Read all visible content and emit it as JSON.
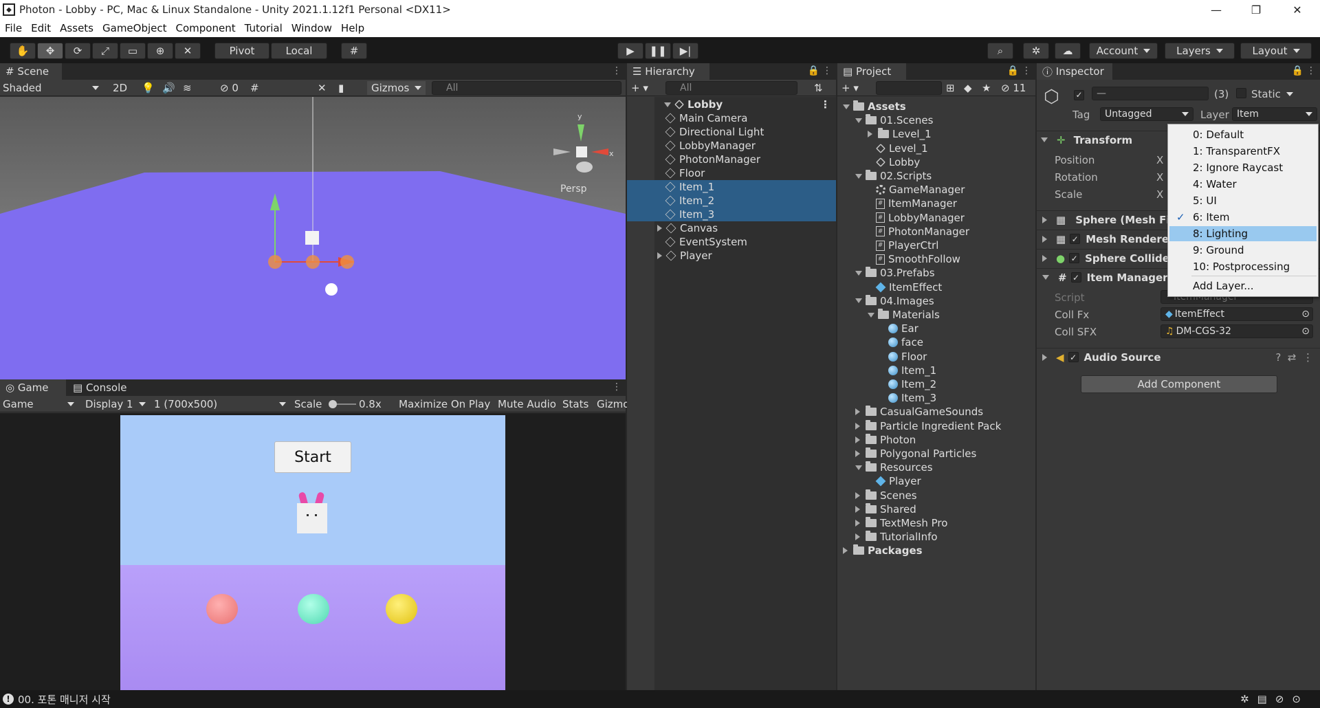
{
  "window": {
    "title": "Photon - Lobby - PC, Mac & Linux Standalone - Unity 2021.1.12f1 Personal <DX11>"
  },
  "menu": [
    "File",
    "Edit",
    "Assets",
    "GameObject",
    "Component",
    "Tutorial",
    "Window",
    "Help"
  ],
  "toolbar": {
    "pivot": "Pivot",
    "local": "Local",
    "account": "Account",
    "layers": "Layers",
    "layout": "Layout"
  },
  "scene": {
    "tab": "Scene",
    "shading": "Shaded",
    "mode2d": "2D",
    "hidden_count": "0",
    "gizmos": "Gizmos",
    "search_placeholder": "All",
    "persp": "Persp",
    "gizmo_axes": {
      "x": "x",
      "y": "y"
    }
  },
  "game": {
    "tab": "Game",
    "console_tab": "Console",
    "view": "Game",
    "display": "Display 1",
    "resolution": "1 (700x500)",
    "scale_label": "Scale",
    "scale_value": "0.8x",
    "maximize": "Maximize On Play",
    "mute": "Mute Audio",
    "stats": "Stats",
    "gizmos": "Gizmo",
    "start_button": "Start",
    "sky_color": "#a9cbf9",
    "floor_color": "#b08ef7",
    "balls": [
      "#f08a8a",
      "#7be8c8",
      "#f2dc3c"
    ]
  },
  "hierarchy": {
    "tab": "Hierarchy",
    "search_placeholder": "All",
    "root": "Lobby",
    "items": [
      {
        "label": "Main Camera",
        "selected": false,
        "expandable": false
      },
      {
        "label": "Directional Light",
        "selected": false,
        "expandable": false
      },
      {
        "label": "LobbyManager",
        "selected": false,
        "expandable": false
      },
      {
        "label": "PhotonManager",
        "selected": false,
        "expandable": false
      },
      {
        "label": "Floor",
        "selected": false,
        "expandable": false
      },
      {
        "label": "Item_1",
        "selected": true,
        "expandable": false
      },
      {
        "label": "Item_2",
        "selected": true,
        "expandable": false
      },
      {
        "label": "Item_3",
        "selected": true,
        "expandable": false
      },
      {
        "label": "Canvas",
        "selected": false,
        "expandable": true
      },
      {
        "label": "EventSystem",
        "selected": false,
        "expandable": false
      },
      {
        "label": "Player",
        "selected": false,
        "expandable": true
      }
    ]
  },
  "project": {
    "tab": "Project",
    "hidden_count": "11",
    "tree": [
      {
        "label": "Assets",
        "depth": 0,
        "icon": "folder",
        "arrow": "down",
        "bold": true
      },
      {
        "label": "01.Scenes",
        "depth": 1,
        "icon": "folder",
        "arrow": "down"
      },
      {
        "label": "Level_1",
        "depth": 2,
        "icon": "folder",
        "arrow": "right"
      },
      {
        "label": "Level_1",
        "depth": 2,
        "icon": "unity",
        "arrow": "none"
      },
      {
        "label": "Lobby",
        "depth": 2,
        "icon": "unity",
        "arrow": "none"
      },
      {
        "label": "02.Scripts",
        "depth": 1,
        "icon": "folder",
        "arrow": "down"
      },
      {
        "label": "GameManager",
        "depth": 2,
        "icon": "gear",
        "arrow": "none"
      },
      {
        "label": "ItemManager",
        "depth": 2,
        "icon": "script",
        "arrow": "none"
      },
      {
        "label": "LobbyManager",
        "depth": 2,
        "icon": "script",
        "arrow": "none"
      },
      {
        "label": "PhotonManager",
        "depth": 2,
        "icon": "script",
        "arrow": "none"
      },
      {
        "label": "PlayerCtrl",
        "depth": 2,
        "icon": "script",
        "arrow": "none"
      },
      {
        "label": "SmoothFollow",
        "depth": 2,
        "icon": "script",
        "arrow": "none"
      },
      {
        "label": "03.Prefabs",
        "depth": 1,
        "icon": "folder",
        "arrow": "down"
      },
      {
        "label": "ItemEffect",
        "depth": 2,
        "icon": "prefab",
        "arrow": "none"
      },
      {
        "label": "04.Images",
        "depth": 1,
        "icon": "folder",
        "arrow": "down"
      },
      {
        "label": "Materials",
        "depth": 2,
        "icon": "folder",
        "arrow": "down"
      },
      {
        "label": "Ear",
        "depth": 3,
        "icon": "mat",
        "arrow": "none"
      },
      {
        "label": "face",
        "depth": 3,
        "icon": "mat",
        "arrow": "none"
      },
      {
        "label": "Floor",
        "depth": 3,
        "icon": "mat",
        "arrow": "none"
      },
      {
        "label": "Item_1",
        "depth": 3,
        "icon": "mat",
        "arrow": "none"
      },
      {
        "label": "Item_2",
        "depth": 3,
        "icon": "mat",
        "arrow": "none"
      },
      {
        "label": "Item_3",
        "depth": 3,
        "icon": "mat",
        "arrow": "none"
      },
      {
        "label": "CasualGameSounds",
        "depth": 1,
        "icon": "folder",
        "arrow": "right"
      },
      {
        "label": "Particle Ingredient Pack",
        "depth": 1,
        "icon": "folder",
        "arrow": "right"
      },
      {
        "label": "Photon",
        "depth": 1,
        "icon": "folder",
        "arrow": "right"
      },
      {
        "label": "Polygonal Particles",
        "depth": 1,
        "icon": "folder",
        "arrow": "right"
      },
      {
        "label": "Resources",
        "depth": 1,
        "icon": "folder",
        "arrow": "down"
      },
      {
        "label": "Player",
        "depth": 2,
        "icon": "prefab",
        "arrow": "none"
      },
      {
        "label": "Scenes",
        "depth": 1,
        "icon": "folder",
        "arrow": "right"
      },
      {
        "label": "Shared",
        "depth": 1,
        "icon": "folder",
        "arrow": "right"
      },
      {
        "label": "TextMesh Pro",
        "depth": 1,
        "icon": "folder",
        "arrow": "right"
      },
      {
        "label": "TutorialInfo",
        "depth": 1,
        "icon": "folder",
        "arrow": "right"
      },
      {
        "label": "Packages",
        "depth": 0,
        "icon": "folder",
        "arrow": "right",
        "bold": true
      }
    ]
  },
  "inspector": {
    "tab": "Inspector",
    "name_value": "—",
    "count": "(3)",
    "static_label": "Static",
    "tag_label": "Tag",
    "tag_value": "Untagged",
    "layer_label": "Layer",
    "layer_value": "Item",
    "transform": {
      "title": "Transform",
      "rows": [
        "Position",
        "Rotation",
        "Scale"
      ],
      "axis": "X"
    },
    "components": [
      "Sphere (Mesh Filter)",
      "Mesh Renderer",
      "Sphere Collider",
      "Item Manager (Script)"
    ],
    "item_manager": {
      "script_label": "Script",
      "script_value": "ItemManager",
      "coll_fx_label": "Coll Fx",
      "coll_fx_value": "ItemEffect",
      "coll_sfx_label": "Coll SFX",
      "coll_sfx_value": "DM-CGS-32"
    },
    "audio": "Audio Source",
    "add_component": "Add Component"
  },
  "layer_dropdown": {
    "items": [
      {
        "label": "0: Default",
        "checked": false,
        "highlighted": false
      },
      {
        "label": "1: TransparentFX",
        "checked": false,
        "highlighted": false
      },
      {
        "label": "2: Ignore Raycast",
        "checked": false,
        "highlighted": false
      },
      {
        "label": "4: Water",
        "checked": false,
        "highlighted": false
      },
      {
        "label": "5: UI",
        "checked": false,
        "highlighted": false
      },
      {
        "label": "6: Item",
        "checked": true,
        "highlighted": false
      },
      {
        "label": "8: Lighting",
        "checked": false,
        "highlighted": true
      },
      {
        "label": "9: Ground",
        "checked": false,
        "highlighted": false
      },
      {
        "label": "10: Postprocessing",
        "checked": false,
        "highlighted": false
      }
    ],
    "add": "Add Layer..."
  },
  "status": {
    "message": "00. 포톤 매니저 시작"
  }
}
